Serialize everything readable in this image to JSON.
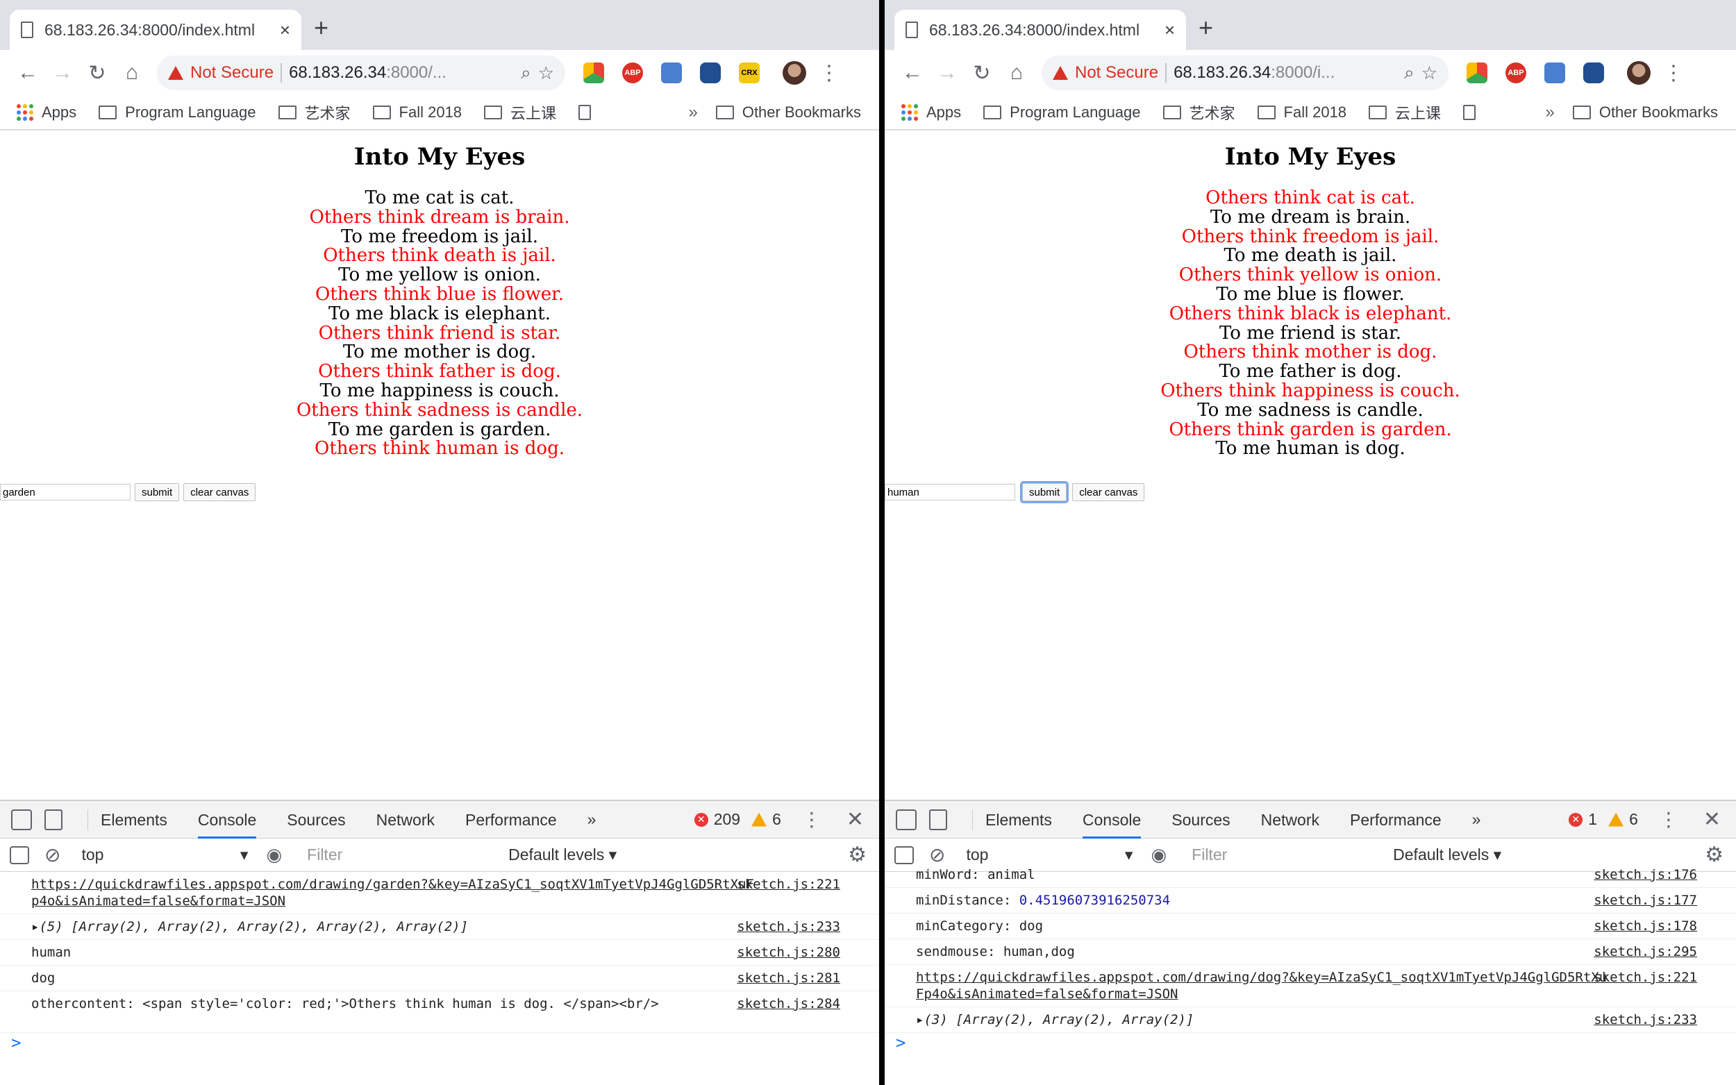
{
  "browser": {
    "tab_title": "68.183.26.34:8000/index.html",
    "tab_close": "×",
    "new_tab": "+",
    "not_secure": "Not Secure",
    "extension_crx": "CRX",
    "extension_abp": "ABP"
  },
  "bookmarks": {
    "items": [
      {
        "label": "Apps",
        "icon": "apps-grid-icon"
      },
      {
        "label": "Program Language",
        "icon": "folder-icon"
      },
      {
        "label": "艺术家",
        "icon": "folder-icon"
      },
      {
        "label": "Fall 2018",
        "icon": "folder-icon"
      },
      {
        "label": "云上课",
        "icon": "folder-icon"
      }
    ],
    "overflow": "»",
    "other": "Other Bookmarks"
  },
  "page": {
    "title": "Into My Eyes",
    "submit": "submit",
    "clear": "clear canvas"
  },
  "devtools": {
    "tabs": [
      "Elements",
      "Console",
      "Sources",
      "Network",
      "Performance"
    ],
    "more_tabs": "»",
    "context": "top",
    "filter_placeholder": "Filter",
    "levels": "Default levels ▾"
  },
  "left": {
    "url_host": "68.183.26.34",
    "url_rest": ":8000/...",
    "input_value": "garden",
    "poem": [
      {
        "text": "To me cat is cat.",
        "red": false
      },
      {
        "text": "Others think dream is brain.",
        "red": true
      },
      {
        "text": "To me freedom is jail.",
        "red": false
      },
      {
        "text": "Others think death is jail.",
        "red": true
      },
      {
        "text": "To me yellow is onion.",
        "red": false
      },
      {
        "text": "Others think blue is flower.",
        "red": true
      },
      {
        "text": "To me black is elephant.",
        "red": false
      },
      {
        "text": "Others think friend is star.",
        "red": true
      },
      {
        "text": "To me mother is dog.",
        "red": false
      },
      {
        "text": "Others think father is dog.",
        "red": true
      },
      {
        "text": "To me happiness is couch.",
        "red": false
      },
      {
        "text": "Others think sadness is candle.",
        "red": true
      },
      {
        "text": "To me garden is garden.",
        "red": false
      },
      {
        "text": "Others think human is dog.",
        "red": true
      }
    ],
    "errors": "209",
    "warnings": "6",
    "console": [
      {
        "text": "https://quickdrawfiles.appspot.com/drawing/garden?&key=AIzaSyC1_soqtXV1mTyetVpJ4GglGD5RtXuFp4o&isAnimated=false&format=JSON",
        "src": "sketch.js:221",
        "link": true
      },
      {
        "text": "▸(5) [Array(2), Array(2), Array(2), Array(2), Array(2)]",
        "src": "sketch.js:233",
        "italic": true
      },
      {
        "text": "human",
        "src": "sketch.js:280"
      },
      {
        "text": "dog",
        "src": "sketch.js:281"
      },
      {
        "text": "othercontent:  <span style='color: red;'>Others think human is dog. </span><br/>",
        "src": "sketch.js:284"
      }
    ]
  },
  "right": {
    "url_host": "68.183.26.34",
    "url_rest": ":8000/i...",
    "input_value": "human",
    "poem": [
      {
        "text": "Others think cat is cat.",
        "red": true
      },
      {
        "text": "To me dream is brain.",
        "red": false
      },
      {
        "text": "Others think freedom is jail.",
        "red": true
      },
      {
        "text": "To me death is jail.",
        "red": false
      },
      {
        "text": "Others think yellow is onion.",
        "red": true
      },
      {
        "text": "To me blue is flower.",
        "red": false
      },
      {
        "text": "Others think black is elephant.",
        "red": true
      },
      {
        "text": "To me friend is star.",
        "red": false
      },
      {
        "text": "Others think mother is dog.",
        "red": true
      },
      {
        "text": "To me father is dog.",
        "red": false
      },
      {
        "text": "Others think happiness is couch.",
        "red": true
      },
      {
        "text": "To me sadness is candle.",
        "red": false
      },
      {
        "text": "Others think garden is garden.",
        "red": true
      },
      {
        "text": "To me human is dog.",
        "red": false
      }
    ],
    "errors": "1",
    "warnings": "6",
    "console": [
      {
        "text": "minWord:  animal",
        "src": "sketch.js:176"
      },
      {
        "label": "minDistance:  ",
        "num": "0.45196073916250734",
        "src": "sketch.js:177"
      },
      {
        "text": "minCategory:  dog",
        "src": "sketch.js:178"
      },
      {
        "text": "sendmouse: human,dog",
        "src": "sketch.js:295"
      },
      {
        "text": "https://quickdrawfiles.appspot.com/drawing/dog?&key=AIzaSyC1_soqtXV1mTyetVpJ4GglGD5RtXuFp4o&isAnimated=false&format=JSON",
        "src": "sketch.js:221",
        "link": true
      },
      {
        "text": "▸(3) [Array(2), Array(2), Array(2)]",
        "src": "sketch.js:233",
        "italic": true
      }
    ]
  },
  "console_prompt": ">"
}
